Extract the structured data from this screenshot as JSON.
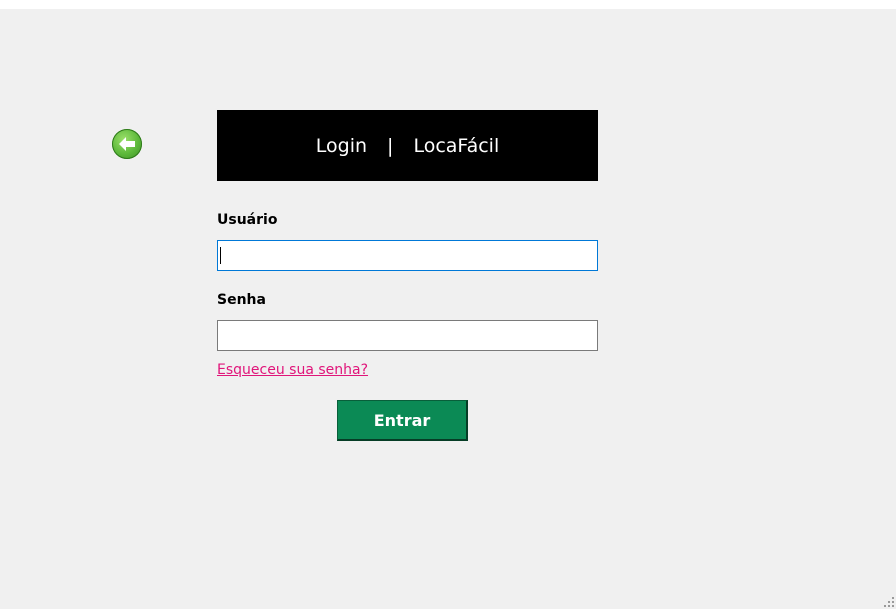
{
  "header": {
    "login_label": "Login",
    "separator": "|",
    "app_name": "LocaFácil"
  },
  "form": {
    "username_label": "Usuário",
    "username_value": "",
    "password_label": "Senha",
    "password_value": "",
    "forgot_link": "Esqueceu sua senha?",
    "submit_label": "Entrar"
  },
  "icons": {
    "back": "back-arrow-icon",
    "resize": "resize-grip-icon"
  },
  "colors": {
    "header_bg": "#000000",
    "submit_bg": "#0b8a55",
    "link": "#e0157a",
    "focus_border": "#0078d7",
    "back_icon": "#5cb83a"
  }
}
